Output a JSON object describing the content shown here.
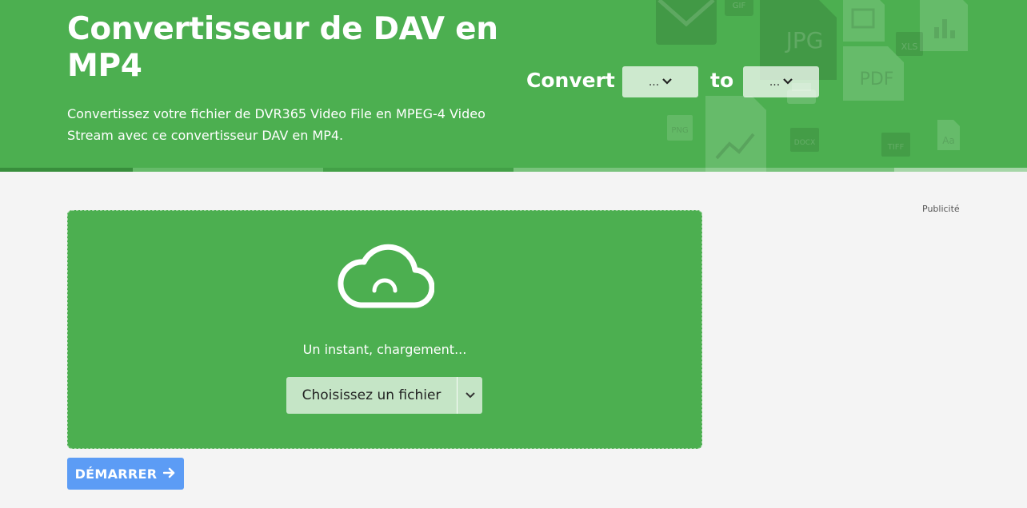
{
  "hero": {
    "title": "Convertisseur de DAV en MP4",
    "description": "Convertissez votre fichier de DVR365 Video File en MPEG-4 Video Stream avec ce convertisseur DAV en MP4.",
    "convert_label": "Convert",
    "to_label": "to",
    "from_select_value": "...",
    "to_select_value": "...",
    "background_icons": [
      "mail-icon",
      "gif-file-icon",
      "jpg-file-icon",
      "image-file-icon",
      "chart-file-icon",
      "xls-file-icon",
      "pdf-file-icon",
      "png-file-icon",
      "printer-icon",
      "trend-chart-file-icon",
      "docx-file-icon",
      "tiff-file-icon",
      "font-file-icon"
    ],
    "bg_icon_labels": {
      "gif": "GIF",
      "jpg": "JPG",
      "xls": "XLS",
      "pdf": "PDF",
      "png": "PNG",
      "docx": "DOCX",
      "tiff": "TIFF",
      "font": "Aa"
    }
  },
  "ad": {
    "label": "Publicité"
  },
  "upload": {
    "loading_text": "Un instant, chargement...",
    "choose_file_label": "Choisissez un fichier",
    "icon": "cloud-loading-icon"
  },
  "actions": {
    "start_label": "DÉMARRER"
  },
  "colors": {
    "brand_green": "#4caf50",
    "start_button_blue": "#5c9cf5",
    "page_background": "#f4f4f4"
  }
}
